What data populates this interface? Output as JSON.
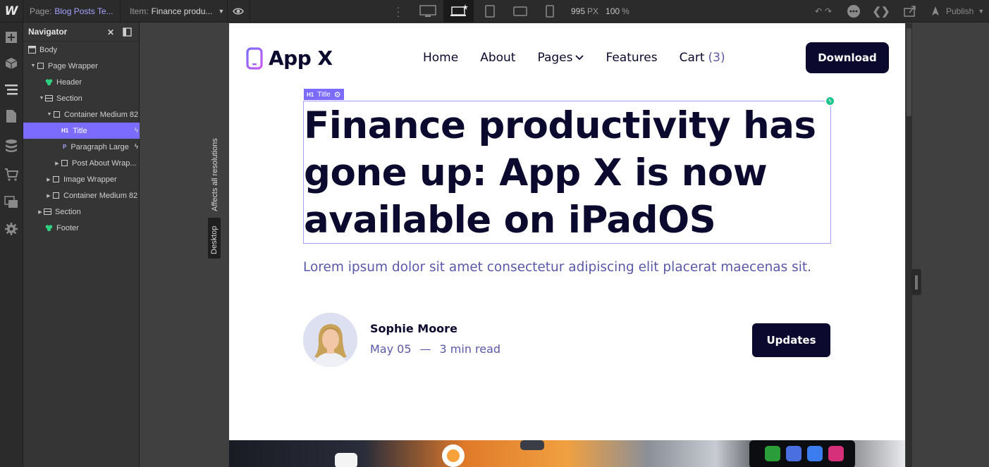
{
  "toolbar": {
    "page_label": "Page:",
    "page_value": "Blog Posts Te...",
    "item_label": "Item:",
    "item_value": "Finance produ...",
    "zoom_width": "995",
    "zoom_width_unit": "PX",
    "zoom_percent": "100",
    "zoom_percent_unit": "%",
    "publish_label": "Publish"
  },
  "navigator": {
    "title": "Navigator",
    "items": [
      {
        "label": "Body"
      },
      {
        "label": "Page Wrapper"
      },
      {
        "label": "Header"
      },
      {
        "label": "Section"
      },
      {
        "label": "Container Medium 82"
      },
      {
        "label": "Title",
        "tag": "H1"
      },
      {
        "label": "Paragraph Large",
        "tag": "P"
      },
      {
        "label": "Post About Wrap..."
      },
      {
        "label": "Image Wrapper"
      },
      {
        "label": "Container Medium 82"
      },
      {
        "label": "Section"
      },
      {
        "label": "Footer"
      }
    ]
  },
  "side_labels": {
    "affects": "Affects all resolutions",
    "breakpoint": "Desktop"
  },
  "site": {
    "logo_text": "App X",
    "nav": [
      "Home",
      "About",
      "Pages",
      "Features",
      "Cart"
    ],
    "cart_count": "(3)",
    "download_label": "Download",
    "selection_tag_type": "H1",
    "selection_tag_label": "Title",
    "title": "Finance productivity has gone up: App X is now available on iPadOS",
    "lead": "Lorem ipsum dolor sit amet consectetur adipiscing elit placerat maecenas sit.",
    "author_name": "Sophie Moore",
    "date": "May 05",
    "separator": "—",
    "read_time": "3 min read",
    "updates_label": "Updates"
  },
  "colors": {
    "accent": "#7b6cff",
    "dark_navy": "#0b0a2e",
    "muted_purple": "#5a58a8",
    "success": "#1fc38c"
  }
}
